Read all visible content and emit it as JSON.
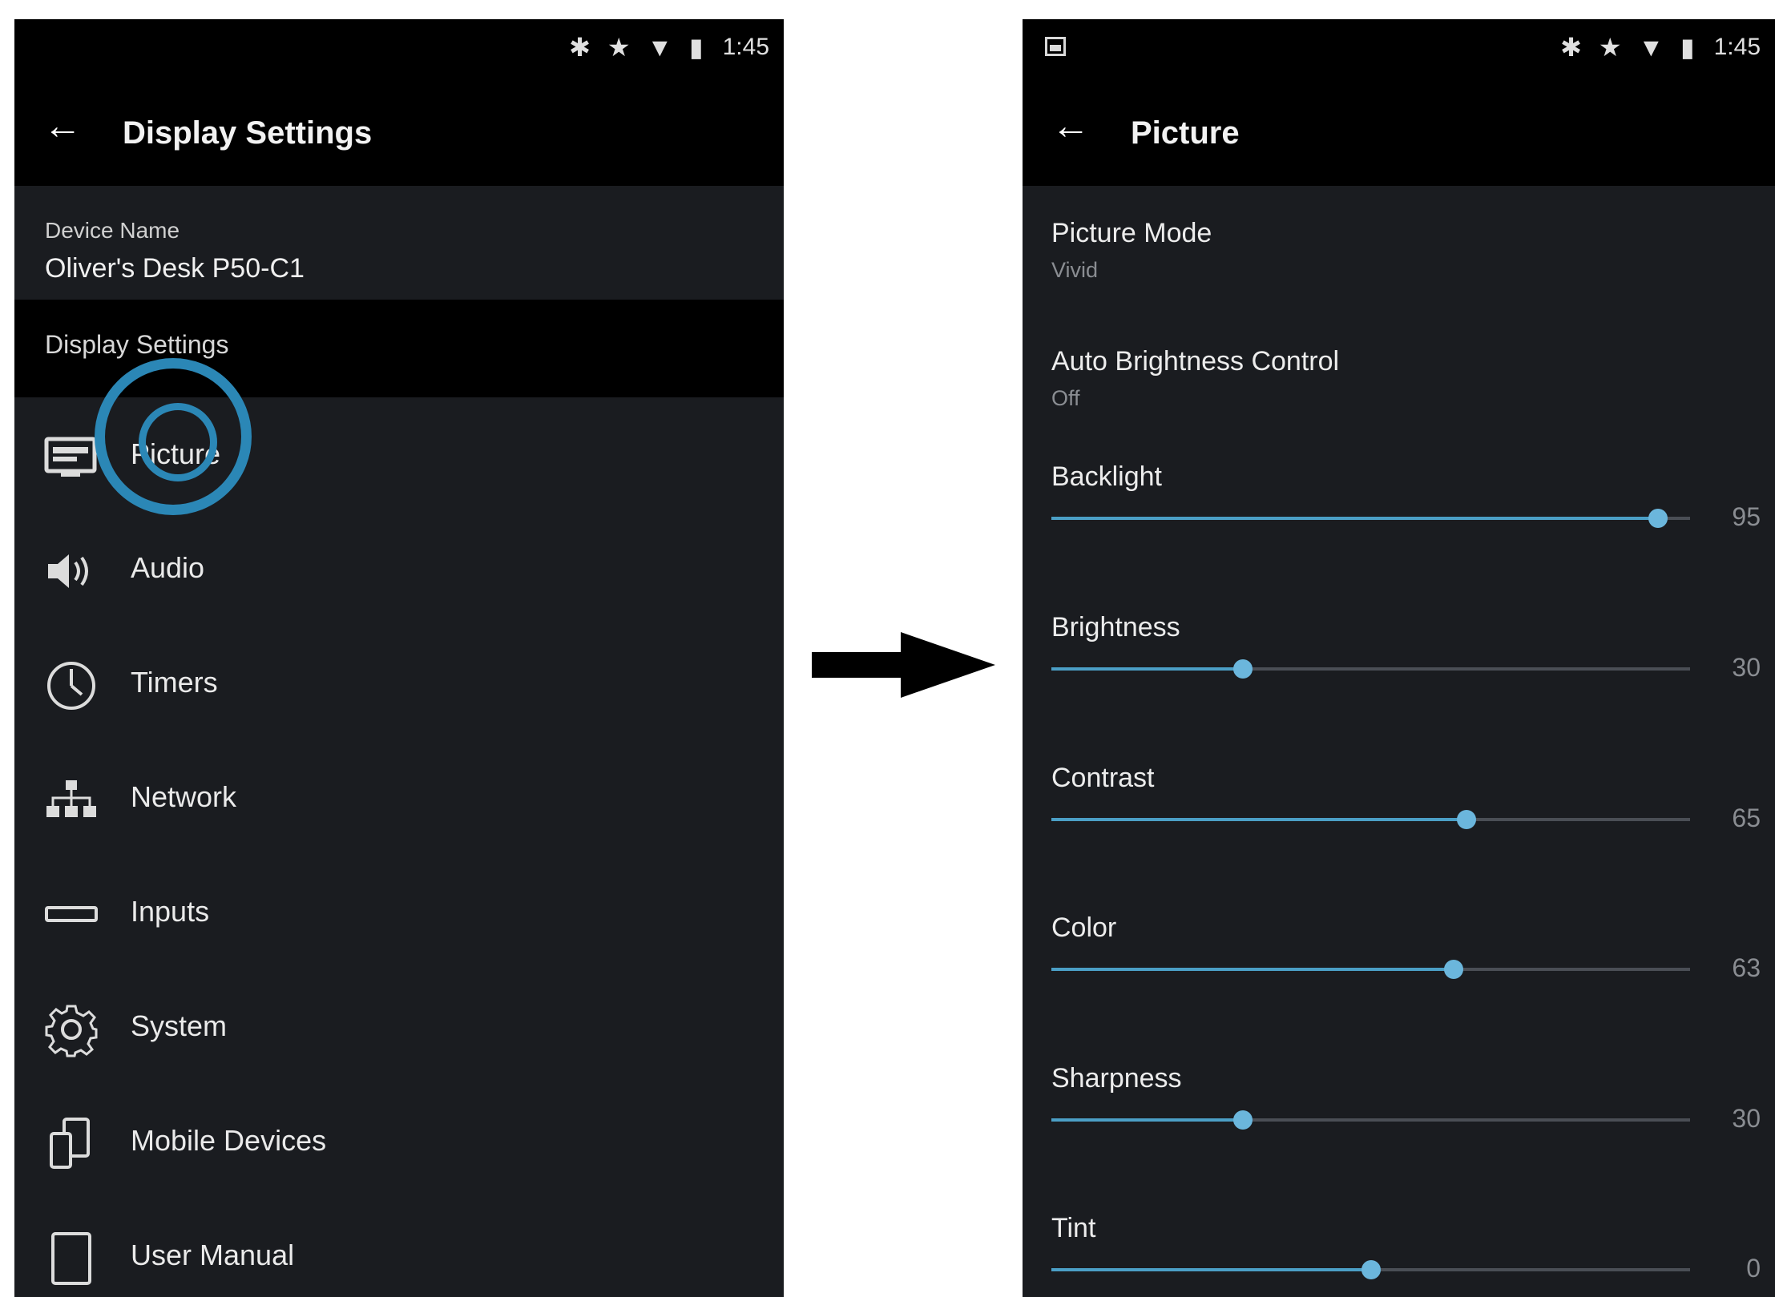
{
  "status_bar": {
    "icons": "✱ ★ ▼ ▮",
    "time": "1:45"
  },
  "left_screen": {
    "title": "Display Settings",
    "device_name_label": "Device Name",
    "device_name_value": "Oliver's Desk P50-C1",
    "section_header": "Display Settings",
    "menu_items": [
      {
        "label": "Picture",
        "icon": "monitor-icon"
      },
      {
        "label": "Audio",
        "icon": "speaker-icon"
      },
      {
        "label": "Timers",
        "icon": "clock-icon"
      },
      {
        "label": "Network",
        "icon": "network-icon"
      },
      {
        "label": "Inputs",
        "icon": "input-port-icon"
      },
      {
        "label": "System",
        "icon": "gear-icon"
      },
      {
        "label": "Mobile Devices",
        "icon": "mobile-devices-icon"
      },
      {
        "label": "User Manual",
        "icon": "tablet-icon"
      }
    ]
  },
  "right_screen": {
    "title": "Picture",
    "picture_mode": {
      "label": "Picture Mode",
      "value": "Vivid"
    },
    "auto_brightness": {
      "label": "Auto Brightness Control",
      "value": "Off"
    },
    "sliders": [
      {
        "label": "Backlight",
        "value": "95",
        "fraction": 0.95
      },
      {
        "label": "Brightness",
        "value": "30",
        "fraction": 0.3
      },
      {
        "label": "Contrast",
        "value": "65",
        "fraction": 0.65
      },
      {
        "label": "Color",
        "value": "63",
        "fraction": 0.63
      },
      {
        "label": "Sharpness",
        "value": "30",
        "fraction": 0.3
      },
      {
        "label": "Tint",
        "value": "0",
        "fraction": 0.5
      }
    ]
  },
  "colors": {
    "accent": "#4b9fc6",
    "highlight_ring": "#2b87b6",
    "background": "#1a1c20"
  }
}
